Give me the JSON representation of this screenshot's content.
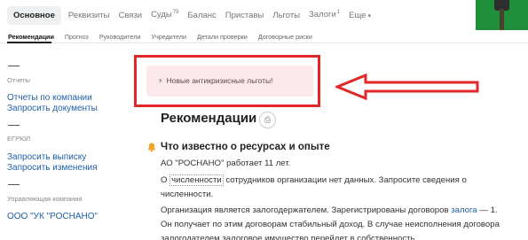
{
  "top_tabs": {
    "main": "Основное",
    "requisites": "Реквизиты",
    "links": "Связи",
    "courts": "Суды",
    "courts_count": "79",
    "balance": "Баланс",
    "bailiffs": "Приставы",
    "benefits": "Льготы",
    "pledges": "Залоги",
    "pledges_count": "1",
    "more": "Еще"
  },
  "sub_tabs": [
    "Рекомендации",
    "Прогноз",
    "Руководители",
    "Учредители",
    "Детали проверки",
    "Договорные риски"
  ],
  "sidebar": {
    "reports_caption": "Отчеты",
    "reports_links": [
      "Отчеты по компании",
      "Запросить документы"
    ],
    "egrul_caption": "ЕГРЮЛ",
    "egrul_links": [
      "Запросить выписку",
      "Запросить изменения"
    ],
    "manager_caption": "Управляющая компания",
    "manager_link": "ООО \"УК \"РОСНАНО\""
  },
  "banner": {
    "text": "Новые антикризисные льготы!"
  },
  "main": {
    "title": "Рекомендации",
    "section_title": "Что известно о ресурсах и опыте",
    "p1": "АО \"РОСНАНО\" работает 11 лет.",
    "p2_a": "О ",
    "p2_term": "численности",
    "p2_b": " сотрудников организации нет данных. Запросите сведения о численности.",
    "p3_a": "Организация является залогодержателем. Зарегистрированы договоров ",
    "p3_link": "залога",
    "p3_b": " — 1. Он получает по этим договорам стабильный доход. В случае неисполнения договора залогодателем залоговое имущество перейдет в собственность"
  }
}
